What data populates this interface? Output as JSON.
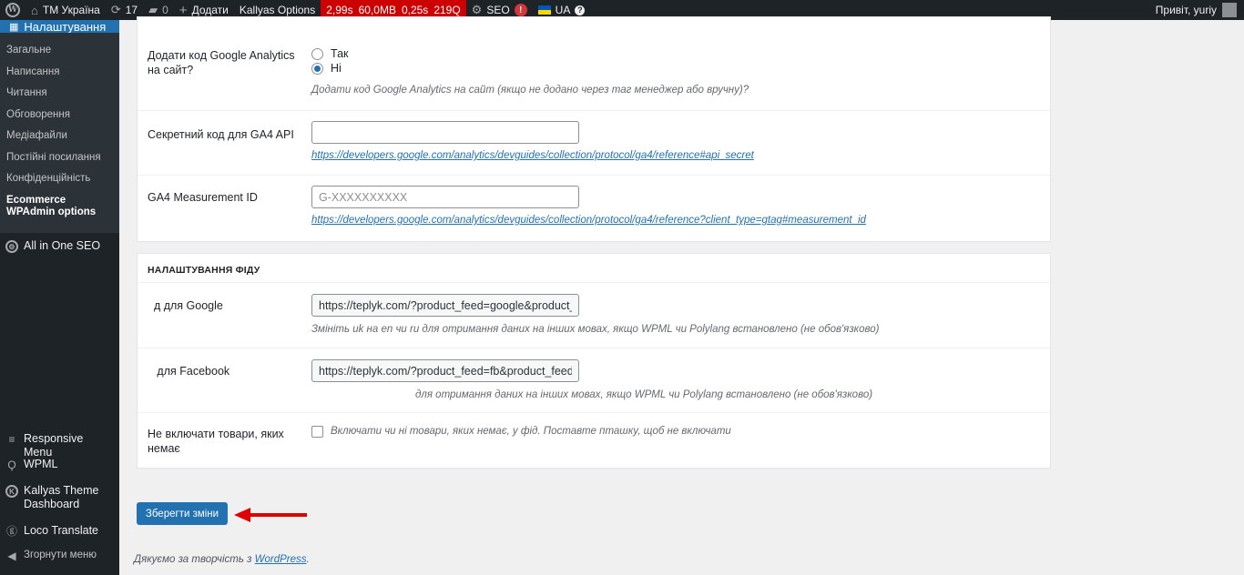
{
  "admin_bar": {
    "site_name": "ТМ Україна",
    "updates_count": "17",
    "comments_count": "0",
    "new_label": "Додати",
    "theme_options": "Kallyas Options",
    "qm_time": "2,99s",
    "qm_memory": "60,0MB",
    "qm_db_time": "0,25s",
    "qm_queries": "219Q",
    "seo_label": "SEO",
    "seo_badge": "!",
    "lang_label": "UA",
    "greeting": "Привіт, yuriy"
  },
  "sidebar": {
    "current_menu": "Налаштування",
    "submenu": [
      {
        "label": "Загальне"
      },
      {
        "label": "Написання"
      },
      {
        "label": "Читання"
      },
      {
        "label": "Обговорення"
      },
      {
        "label": "Медіафайли"
      },
      {
        "label": "Постійні посилання"
      },
      {
        "label": "Конфіденційність"
      },
      {
        "label": "Ecommerce WPAdmin options"
      }
    ],
    "items": [
      {
        "label": "All in One SEO",
        "icon": "aioseo-icon"
      },
      {
        "label": "Responsive Menu",
        "icon": "menu-icon"
      },
      {
        "label": "WPML",
        "icon": "wpml-icon"
      },
      {
        "label": "Kallyas Theme Dashboard",
        "icon": "kallyas-icon"
      },
      {
        "label": "Loco Translate",
        "icon": "translate-icon"
      },
      {
        "label": "Згорнути меню",
        "icon": "collapse-icon"
      }
    ]
  },
  "analytics": {
    "add_ga_label": "Додати код Google Analytics на сайт?",
    "option_yes": "Так",
    "option_no": "Ні",
    "selected": "Ні",
    "add_ga_desc": "Додати код Google Analytics на сайт (якщо не додано через таг менеджер або вручну)?",
    "secret_label": "Секретний код для GA4 API",
    "secret_value": "",
    "secret_link": "https://developers.google.com/analytics/devguides/collection/protocol/ga4/reference#api_secret",
    "measurement_label": "GA4 Measurement ID",
    "measurement_placeholder": "G-XXXXXXXXXX",
    "measurement_link": "https://developers.google.com/analytics/devguides/collection/protocol/ga4/reference?client_type=gtag#measurement_id"
  },
  "feed": {
    "section_title": "НАЛАШТУВАННЯ ФІДУ",
    "google_label": "  д для Google",
    "google_value": "https://teplyk.com/?product_feed=google&product_",
    "google_desc": "Змініть uk на en чи ru для отримання даних на інших мовах, якщо WPML чи Polylang встановлено (не обов'язково)",
    "facebook_label": "   для Facebook",
    "facebook_value": "https://teplyk.com/?product_feed=fb&product_feed",
    "facebook_desc": "для отримання даних на інших мовах, якщо WPML чи Polylang встановлено (не обов'язково)",
    "exclude_label": "Не включати товари, яких немає",
    "exclude_desc": "Включати чи ні товари, яких немає, у фід. Поставте пташку, щоб не включати",
    "exclude_checked": false
  },
  "actions": {
    "save_label": "Зберегти зміни"
  },
  "footer": {
    "text": "Дякуємо за творчість з",
    "link": "WordPress",
    "suffix": "."
  },
  "colors": {
    "admin_bar": "#1d2327",
    "accent": "#2271b1",
    "qm_red": "#cc0000",
    "arrow": "#e10000"
  }
}
